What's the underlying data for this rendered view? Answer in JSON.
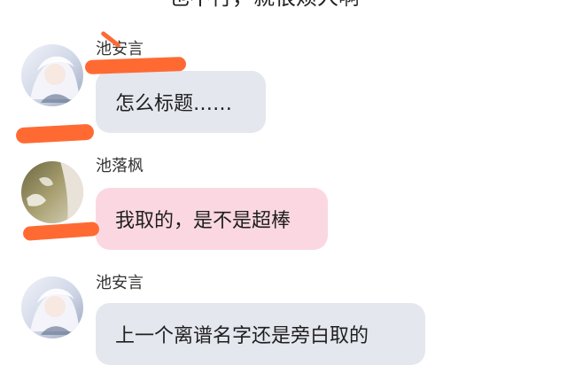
{
  "top_cut_text": "也不行，就很烦人啊",
  "messages": [
    {
      "sender": "池安言",
      "text": "怎么标题……",
      "bubble_style": "gray"
    },
    {
      "sender": "池落枫",
      "text": "我取的，是不是超棒",
      "bubble_style": "pink"
    },
    {
      "sender": "池安言",
      "text": "上一个离谱名字还是旁白取的",
      "bubble_style": "gray"
    }
  ],
  "colors": {
    "gray_bubble": "#e4e7ee",
    "pink_bubble": "#fbd8e1",
    "redaction": "#ff6a33"
  }
}
